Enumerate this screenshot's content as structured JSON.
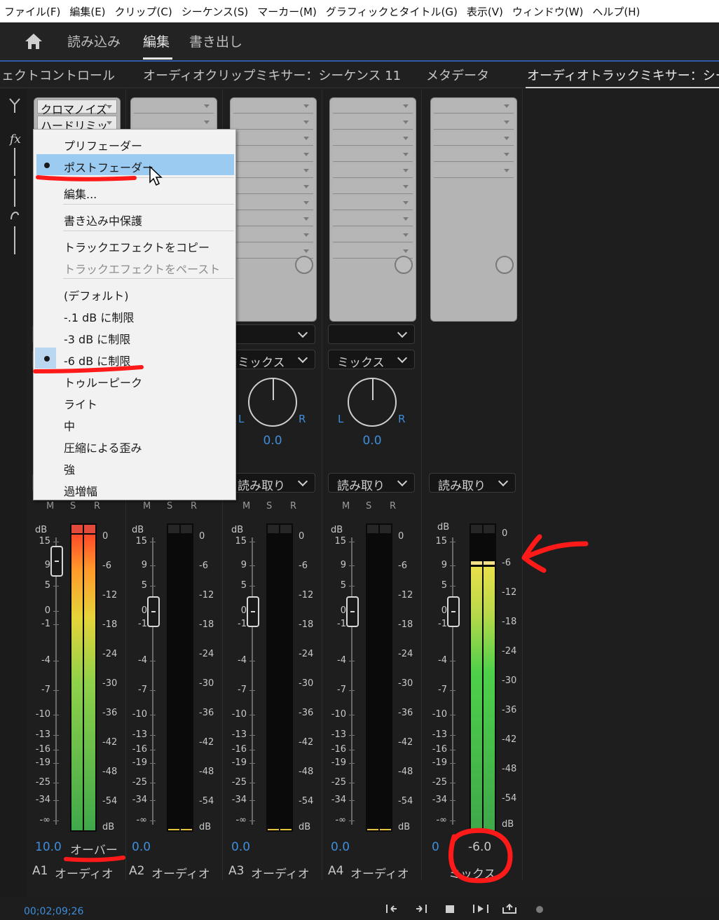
{
  "menubar": [
    "ファイル(F)",
    "編集(E)",
    "クリップ(C)",
    "シーケンス(S)",
    "マーカー(M)",
    "グラフィックとタイトル(G)",
    "表示(V)",
    "ウィンドウ(W)",
    "ヘルプ(H)"
  ],
  "workspace": {
    "home_icon": "home-icon",
    "tabs": [
      "読み込み",
      "編集",
      "書き出し"
    ],
    "active": "編集"
  },
  "panels": {
    "tabs": [
      "ェクトコントロール",
      "オーディオクリップミキサー：シーケンス 11",
      "メタデータ",
      "オーディオトラックミキサー：シー"
    ],
    "active": "オーディオトラックミキサー：シー"
  },
  "fx_slots": {
    "slot1": "クロマノイズ",
    "slot2": "ハードリミッ"
  },
  "menu": {
    "items": [
      {
        "label": "プリフェーダー"
      },
      {
        "label": "ポストフェーダー",
        "checked": true,
        "highlighted": true
      },
      {
        "label": "編集..."
      },
      {
        "label": "書き込み中保護"
      },
      {
        "label": "トラックエフェクトをコピー"
      },
      {
        "label": "トラックエフェクトをペースト",
        "disabled": true
      },
      {
        "label": "(デフォルト)"
      },
      {
        "label": "-.1 dB に制限"
      },
      {
        "label": "-3 dB に制限"
      },
      {
        "label": "-6 dB に制限",
        "checked": true
      },
      {
        "label": "トゥルーピーク"
      },
      {
        "label": "ライト"
      },
      {
        "label": "中"
      },
      {
        "label": "圧縮による歪み"
      },
      {
        "label": "強"
      },
      {
        "label": "過増幅"
      }
    ]
  },
  "strips": {
    "route": "ミックス",
    "automation": "読み取り",
    "pan_l": "L",
    "pan_r": "R",
    "pan_value": "0.0",
    "msr": [
      "M",
      "S",
      "R"
    ],
    "db_label": "dB",
    "fader_scale": [
      "15",
      "9",
      "5",
      "0",
      "-1",
      "-4",
      "-7",
      "-10",
      "-13",
      "-16",
      "-19",
      "-25",
      "-34",
      "-∞"
    ],
    "meter_scale": [
      "0",
      "-6",
      "-12",
      "-18",
      "-24",
      "-30",
      "-36",
      "-42",
      "-48",
      "-54",
      "dB"
    ]
  },
  "tracks": [
    {
      "id": "A1",
      "name": "オーディオ",
      "volume": "10.0",
      "status": "オーバー"
    },
    {
      "id": "A2",
      "name": "オーディオ",
      "volume": "0.0"
    },
    {
      "id": "A3",
      "name": "オーディオ",
      "volume": "0.0"
    },
    {
      "id": "A4",
      "name": "オーディオ",
      "volume": "0.0"
    },
    {
      "id": "",
      "name": "ミックス",
      "volume": "0",
      "mix_value": "-6.0"
    }
  ],
  "timecode": "00;02;09;26",
  "transport_icons": [
    "go-to-in-icon",
    "go-to-out-icon",
    "stop-icon",
    "play-in-to-out-icon",
    "loop-icon",
    "record-icon"
  ],
  "colors": {
    "accent_blue": "#3f8ddb",
    "menu_highlight": "#9ccbf2",
    "annotation_red": "#ff1a1a"
  }
}
